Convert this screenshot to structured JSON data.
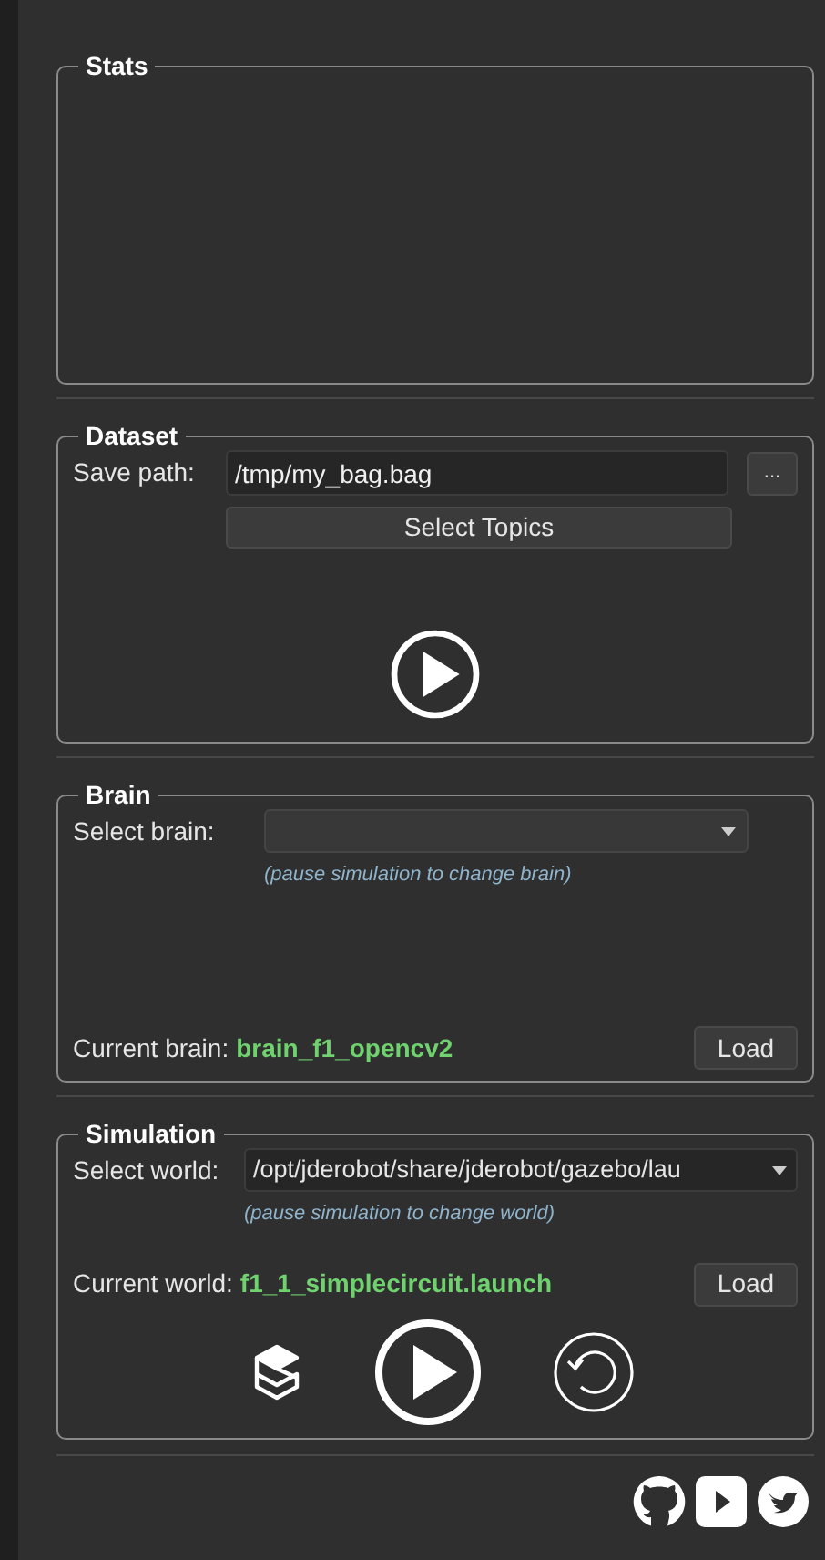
{
  "stats": {
    "title": "Stats"
  },
  "dataset": {
    "title": "Dataset",
    "save_path_label": "Save path:",
    "save_path": "/tmp/my_bag.bag",
    "browse_button": "...",
    "select_topics_button": "Select Topics"
  },
  "brain": {
    "title": "Brain",
    "select_label": "Select brain:",
    "hint": "(pause simulation to change brain)",
    "current_label": "Current brain:",
    "current_value": "brain_f1_opencv2",
    "load_button": "Load"
  },
  "simulation": {
    "title": "Simulation",
    "select_label": "Select world:",
    "world": "/opt/jderobot/share/jderobot/gazebo/lau",
    "hint": "(pause simulation to change world)",
    "current_label": "Current world:",
    "current_value": "f1_1_simplecircuit.launch",
    "load_button": "Load"
  }
}
